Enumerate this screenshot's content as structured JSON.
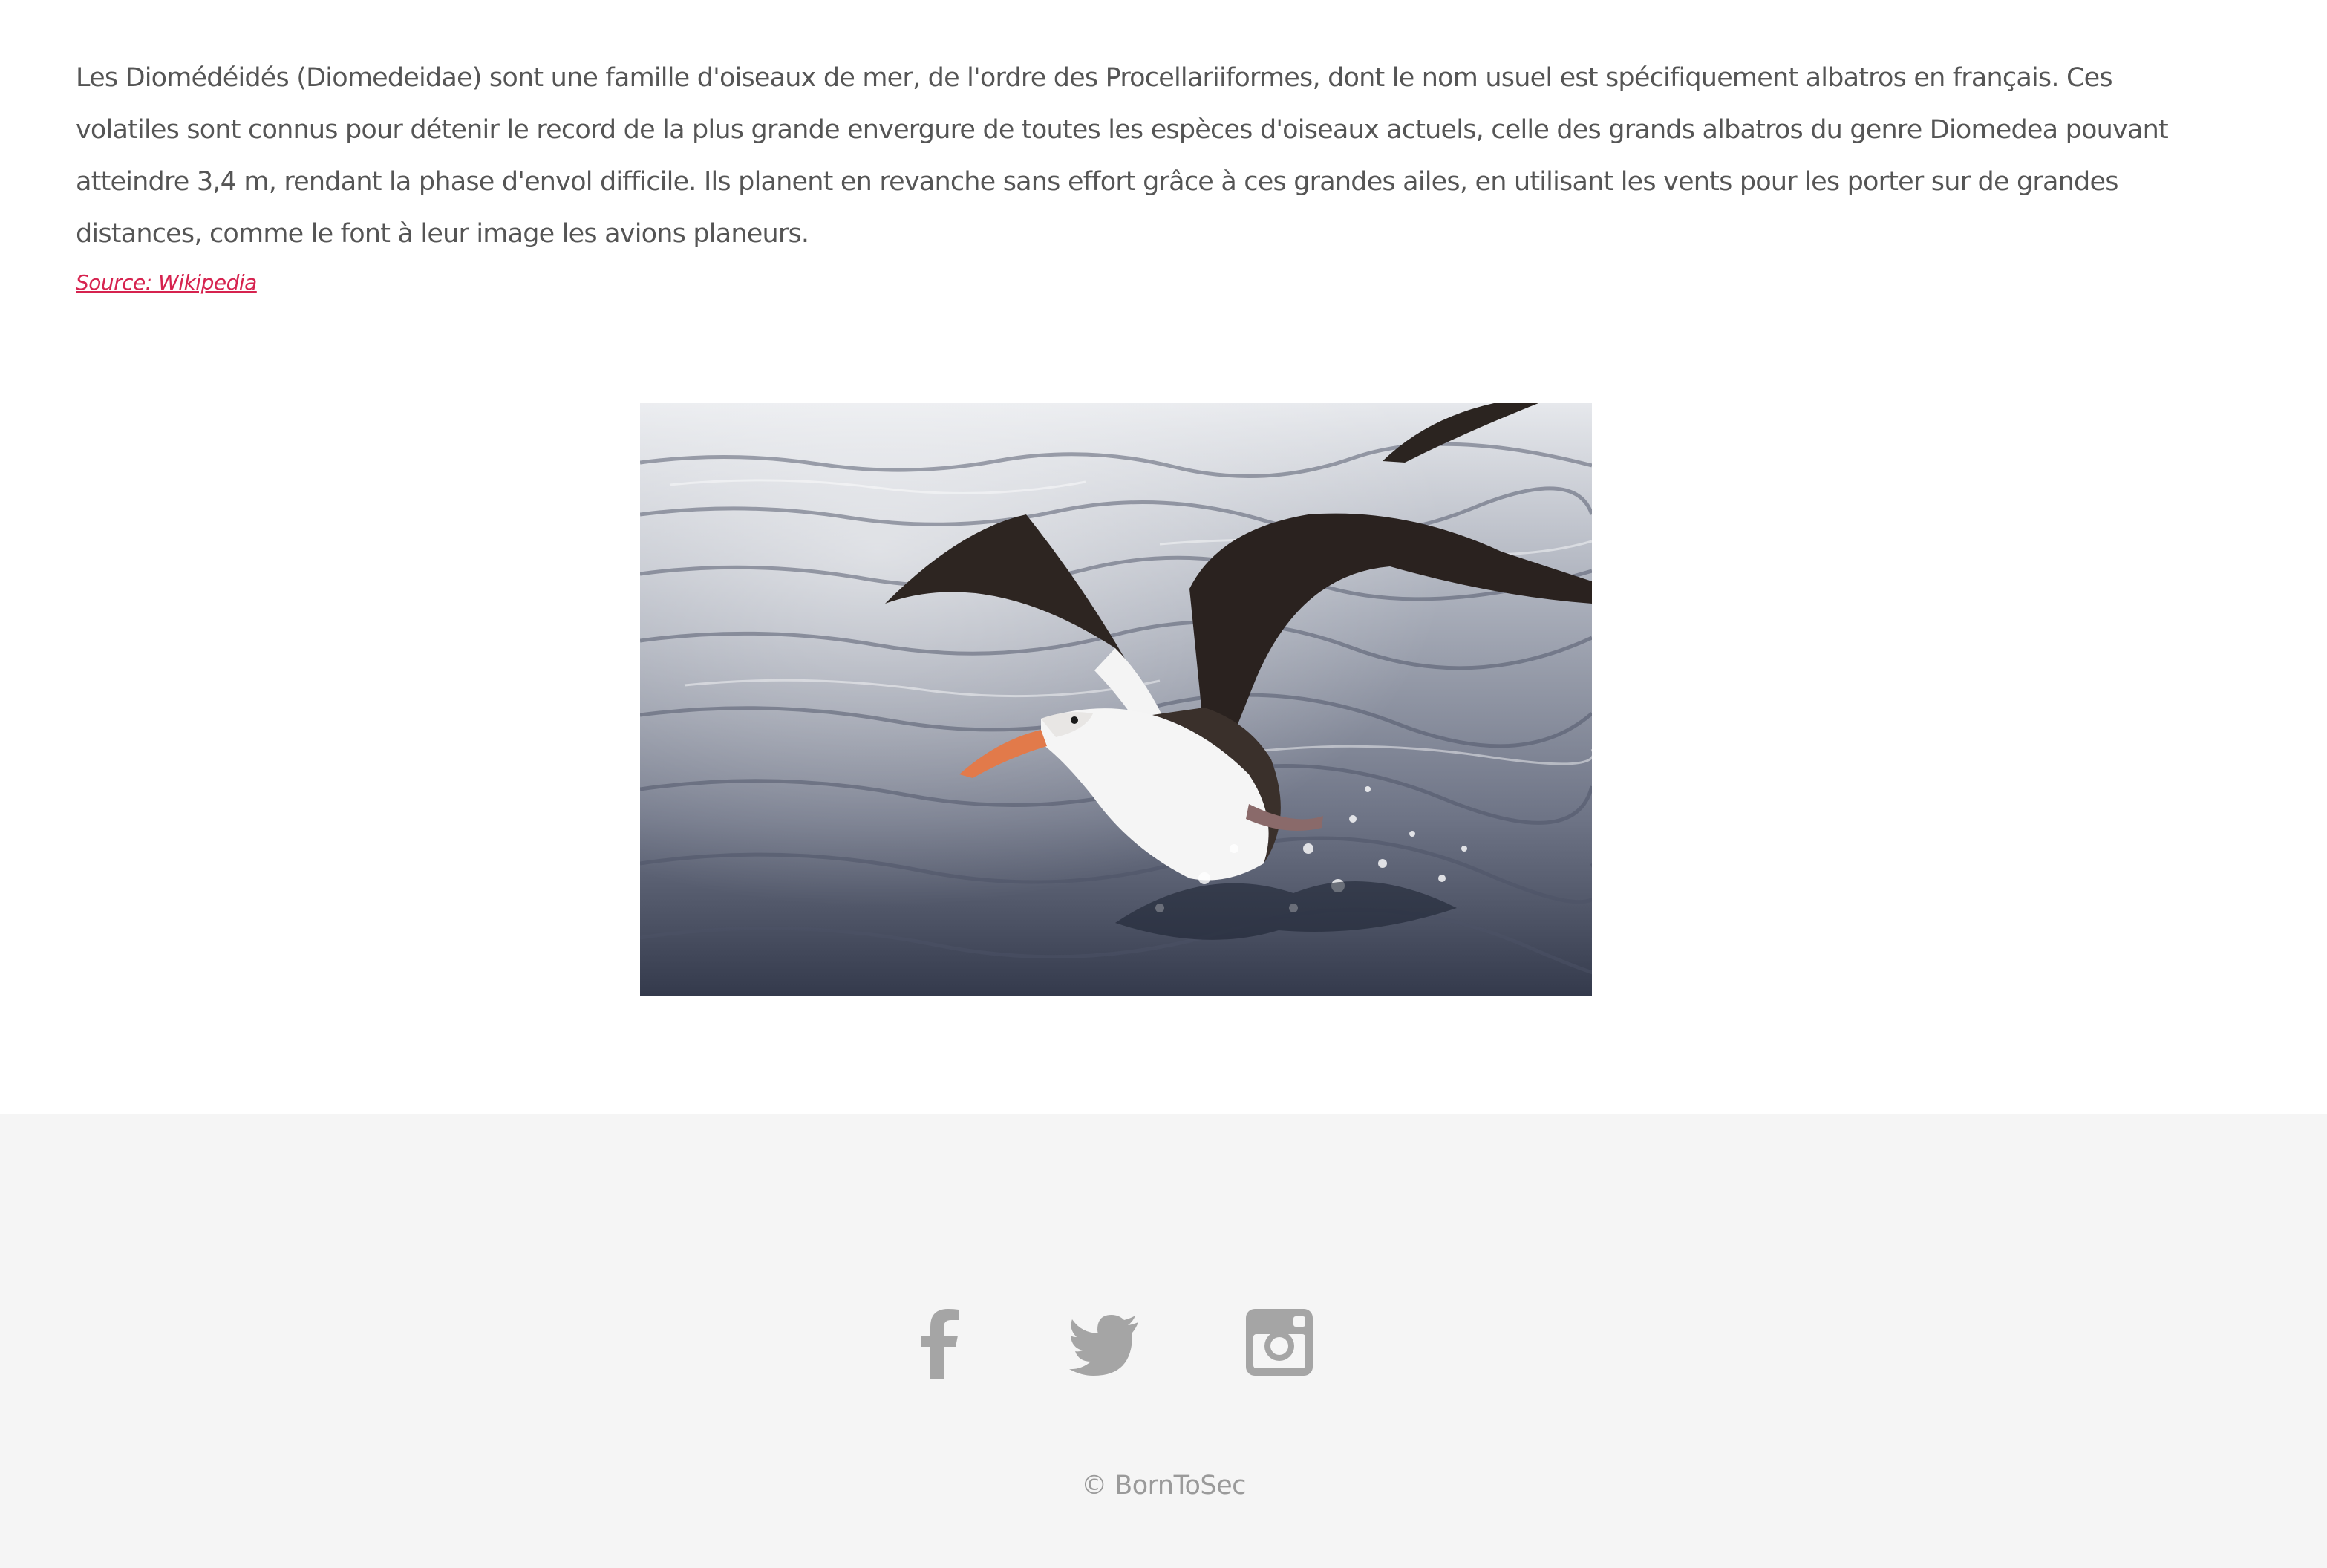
{
  "article": {
    "intro_text": "Les Diomédéidés (Diomedeidae) sont une famille d'oiseaux de mer, de l'ordre des Procellariiformes, dont le nom usuel est spécifiquement albatros en français. Ces volatiles sont connus pour détenir le record de la plus grande envergure de toutes les espèces d'oiseaux actuels, celle des grands albatros du genre Diomedea pouvant atteindre 3,4 m, rendant la phase d'envol difficile. Ils planent en revanche sans effort grâce à ces grandes ailes, en utilisant les vents pour les porter sur de grandes distances, comme le font à leur image les avions planeurs.",
    "source_label": "Source: Wikipedia"
  },
  "footer": {
    "social_icons": [
      "facebook-icon",
      "twitter-icon",
      "instagram-icon"
    ],
    "copyright": "© BornToSec"
  },
  "colors": {
    "body_text": "#555555",
    "link": "#d6234f",
    "footer_bg": "#f5f5f5",
    "footer_icon": "#a5a5a5",
    "footer_text": "#9a9a9a"
  }
}
